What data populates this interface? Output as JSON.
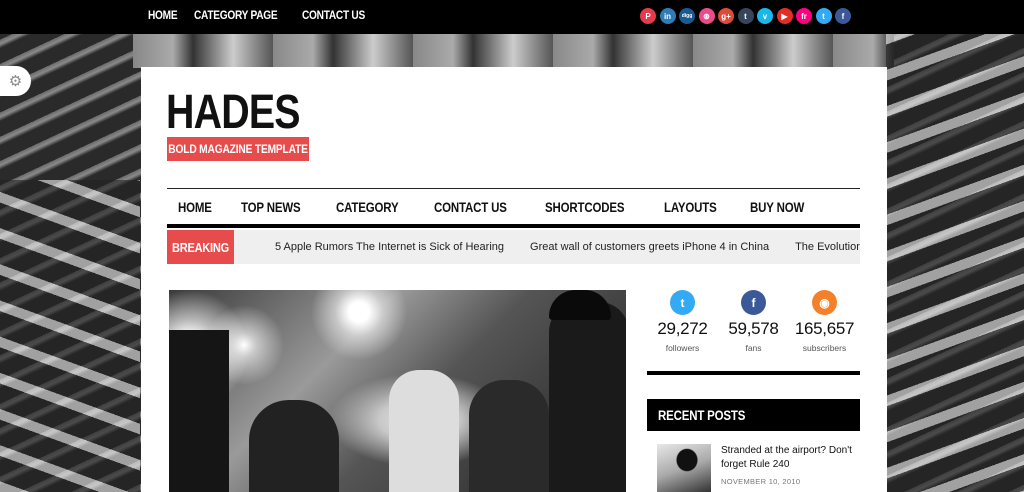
{
  "topbar": {
    "nav": [
      "HOME",
      "CATEGORY PAGE",
      "CONTACT US"
    ],
    "social": [
      {
        "name": "pinterest-icon",
        "glyph": "P",
        "color": "#e23b4e"
      },
      {
        "name": "linkedin-icon",
        "glyph": "in",
        "color": "#2e7bb5"
      },
      {
        "name": "digg-icon",
        "glyph": "digg",
        "color": "#1b5a8f"
      },
      {
        "name": "dribbble-icon",
        "glyph": "⊛",
        "color": "#ea4c89"
      },
      {
        "name": "google-plus-icon",
        "glyph": "g+",
        "color": "#dd4b39"
      },
      {
        "name": "tumblr-icon",
        "glyph": "t",
        "color": "#35465c"
      },
      {
        "name": "vimeo-icon",
        "glyph": "v",
        "color": "#1ab7ea"
      },
      {
        "name": "youtube-icon",
        "glyph": "▶",
        "color": "#e52d27"
      },
      {
        "name": "flickr-icon",
        "glyph": "fr",
        "color": "#ff0084"
      },
      {
        "name": "twitter-icon",
        "glyph": "t",
        "color": "#33aaf3"
      },
      {
        "name": "facebook-icon",
        "glyph": "f",
        "color": "#3b5998"
      }
    ]
  },
  "header": {
    "logo": "HADES",
    "tagline": "BOLD MAGAZINE TEMPLATE"
  },
  "mainnav": [
    "HOME",
    "TOP NEWS",
    "CATEGORY",
    "CONTACT US",
    "SHORTCODES",
    "LAYOUTS",
    "BUY NOW"
  ],
  "breaking": {
    "label": "BREAKING",
    "items": [
      "5 Apple Rumors The Internet is Sick of Hearing",
      "Great wall of customers greets iPhone 4 in China",
      "The Evolution of the A"
    ]
  },
  "stats": [
    {
      "icon": "twitter-icon",
      "glyph": "t",
      "color": "#33aaf3",
      "count": "29,272",
      "label": "followers"
    },
    {
      "icon": "facebook-icon",
      "glyph": "f",
      "color": "#3b5998",
      "count": "59,578",
      "label": "fans"
    },
    {
      "icon": "rss-icon",
      "glyph": "◉",
      "color": "#f4802a",
      "count": "165,657",
      "label": "subscribers"
    }
  ],
  "recent": {
    "heading": "RECENT POSTS",
    "posts": [
      {
        "title": "Stranded at the airport? Don't forget Rule 240",
        "date": "NOVEMBER 10, 2010"
      }
    ]
  }
}
